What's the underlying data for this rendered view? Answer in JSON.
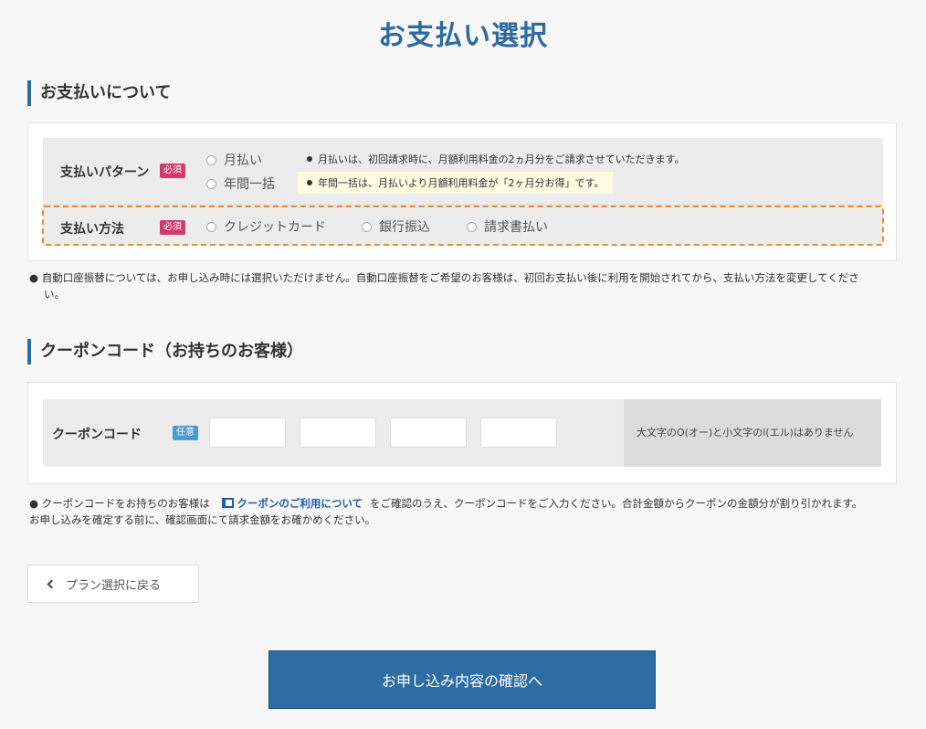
{
  "page": {
    "title": "お支払い選択"
  },
  "payment_section": {
    "heading": "お支払いについて",
    "pattern": {
      "label": "支払いパターン",
      "badge": "必須",
      "options": [
        "月払い",
        "年間一括"
      ],
      "notes": [
        "月払いは、初回請求時に、月額利用料金の2ヵ月分をご請求させていただきます。",
        "年間一括は、月払いより月額利用料金が「2ヶ月分お得」です。"
      ]
    },
    "method": {
      "label": "支払い方法",
      "badge": "必須",
      "options": [
        "クレジットカード",
        "銀行振込",
        "請求書払い"
      ]
    },
    "info_line1": "● 自動口座振替については、お申し込み時には選択いただけません。自動口座振替をご希望のお客様は、初回お支払い後に利用を開始されてから、支払い方法を変更してくださ",
    "info_line2": "い。"
  },
  "coupon_section": {
    "heading": "クーポンコード（お持ちのお客様）",
    "label": "クーポンコード",
    "badge": "任意",
    "hint": "大文字のO(オー)と小文字のl(エル)はありません",
    "info_prefix": "●  クーポンコードをお持ちのお客様は",
    "info_link": "クーポンのご利用について",
    "info_suffix": "をご確認のうえ、クーポンコードをご入力ください。合計金額からクーポンの金額分が割り引かれます。",
    "info_line2": "お申し込みを確定する前に、確認画面にて請求金額をお確かめください。"
  },
  "buttons": {
    "back": "プラン選択に戻る",
    "confirm": "お申し込み内容の確認へ"
  },
  "colors": {
    "accent": "#2c6aa0",
    "required_badge": "#d4386c",
    "optional_badge": "#4a9ad4",
    "highlight_outline": "#f08a24"
  }
}
